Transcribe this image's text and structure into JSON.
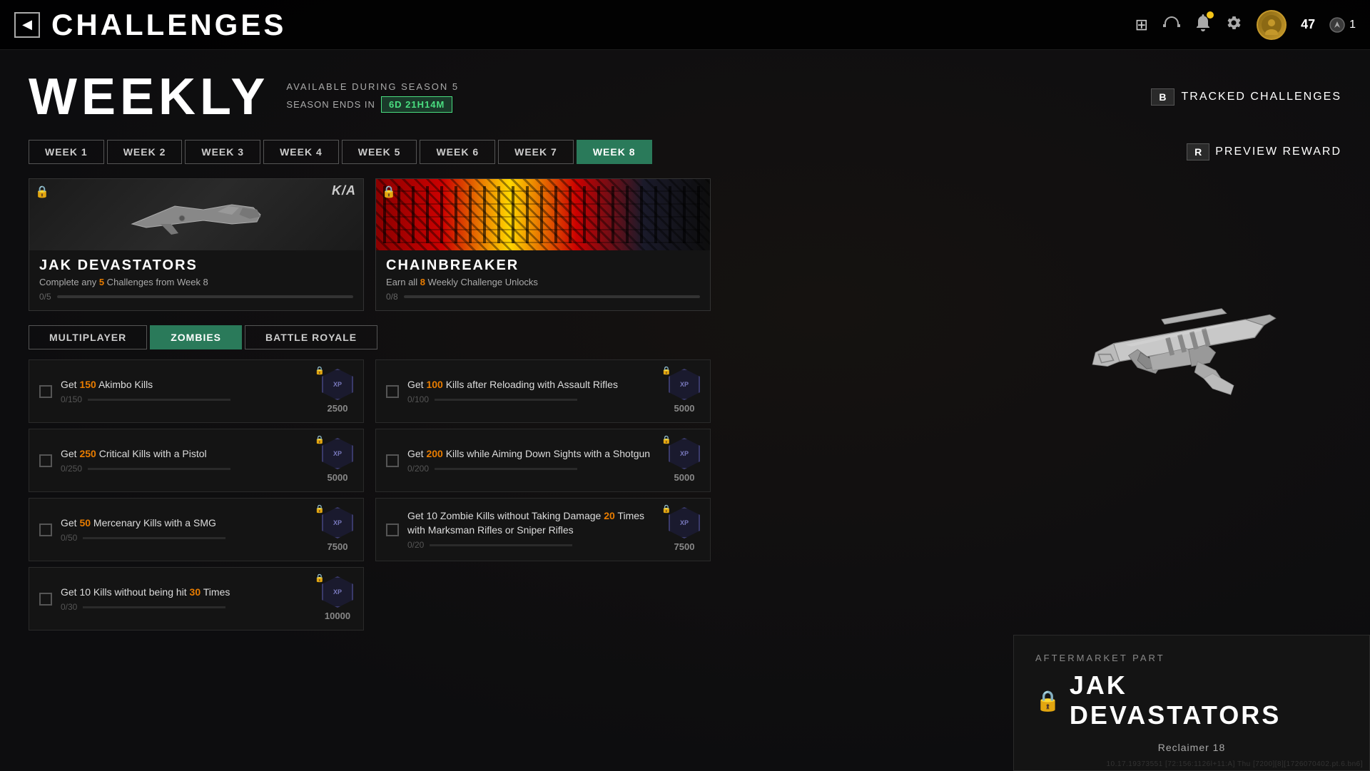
{
  "topBar": {
    "backLabel": "◀",
    "title": "CHALLENGES",
    "icons": {
      "grid": "⊞",
      "headset": "🎧",
      "bell": "🔔",
      "gear": "⚙",
      "level": "47",
      "rank": "1"
    }
  },
  "weekly": {
    "label": "WEEKLY",
    "availableText": "AVAILABLE DURING SEASON 5",
    "seasonEndsLabel": "SEASON ENDS IN",
    "timeRemaining": "6d 21h14m",
    "trackedKey": "B",
    "trackedLabel": "TRACKED CHALLENGES",
    "previewKey": "R",
    "previewLabel": "PREVIEW REWARD"
  },
  "weekTabs": [
    {
      "label": "WEEK 1",
      "active": false
    },
    {
      "label": "WEEK 2",
      "active": false
    },
    {
      "label": "WEEK 3",
      "active": false
    },
    {
      "label": "WEEK 4",
      "active": false
    },
    {
      "label": "WEEK 5",
      "active": false
    },
    {
      "label": "WEEK 6",
      "active": false
    },
    {
      "label": "WEEK 7",
      "active": false
    },
    {
      "label": "WEEK 8",
      "active": true
    }
  ],
  "rewardCards": [
    {
      "id": "jak",
      "name": "JAK DEVASTATORS",
      "desc": "Complete any {5} Challenges from Week 8",
      "descHighlight": "5",
      "progress": "0/5",
      "progressMax": 5,
      "progressVal": 0,
      "locked": true
    },
    {
      "id": "chain",
      "name": "CHAINBREAKER",
      "desc": "Earn all {8} Weekly Challenge Unlocks",
      "descHighlight": "8",
      "progress": "0/8",
      "progressMax": 8,
      "progressVal": 0,
      "locked": true
    }
  ],
  "modeTabs": [
    {
      "label": "MULTIPLAYER",
      "active": false
    },
    {
      "label": "ZOMBIES",
      "active": true
    },
    {
      "label": "BATTLE ROYALE",
      "active": false
    }
  ],
  "challengesLeft": [
    {
      "name": "Get {150} Akimbo Kills",
      "highlight": "150",
      "progress": "0/150",
      "xp": "2500",
      "locked": true
    },
    {
      "name": "Get {250} Critical Kills with a Pistol",
      "highlight": "250",
      "progress": "0/250",
      "xp": "5000",
      "locked": true
    },
    {
      "name": "Get {50} Mercenary Kills with a SMG",
      "highlight": "50",
      "progress": "0/50",
      "xp": "7500",
      "locked": true
    },
    {
      "name": "Get 10 Kills without being hit {30} Times",
      "highlight": "30",
      "progress": "0/30",
      "xp": "10000",
      "locked": true
    }
  ],
  "challengesRight": [
    {
      "name": "Get {100} Kills after Reloading with Assault Rifles",
      "highlight": "100",
      "progress": "0/100",
      "xp": "5000",
      "locked": true
    },
    {
      "name": "Get {200} Kills while Aiming Down Sights with a Shotgun",
      "highlight": "200",
      "progress": "0/200",
      "xp": "5000",
      "locked": true
    },
    {
      "name": "Get 10 Zombie Kills without Taking Damage {20} Times with Marksman Rifles or Sniper Rifles",
      "highlight": "20",
      "progress": "0/20",
      "xp": "7500",
      "locked": true
    }
  ],
  "aftermarketPanel": {
    "label": "AFTERMARKET PART",
    "name": "JAK DEVASTATORS",
    "gunName": "Reclaimer 18"
  },
  "debugText": "10.17.19373551 [72:156:1126l+11:A] Thu [7200][8][1726070402.pt.6.bn6]"
}
